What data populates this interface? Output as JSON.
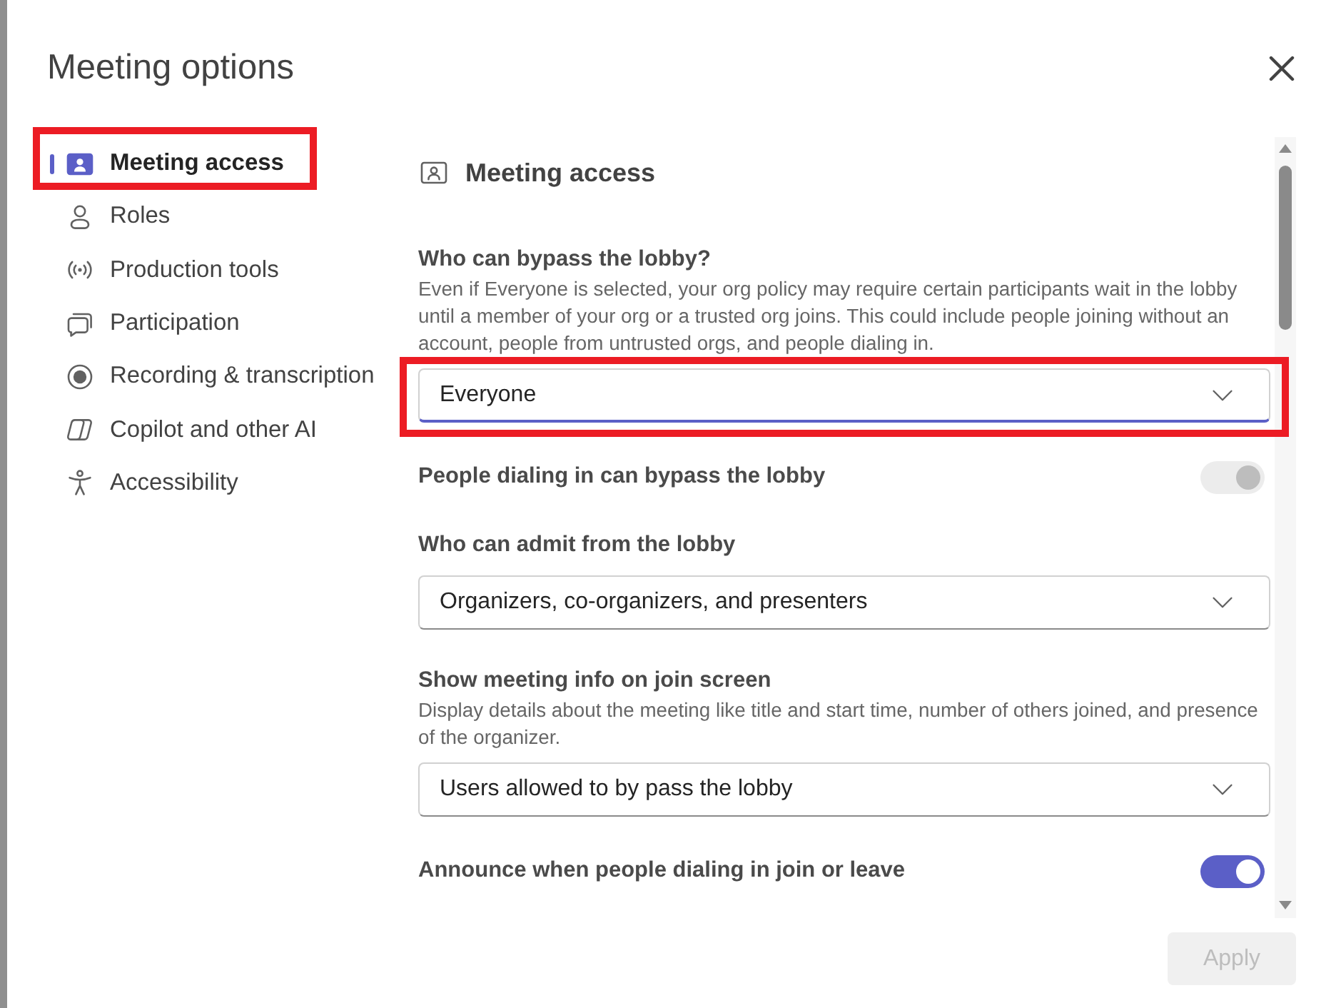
{
  "dialog": {
    "title": "Meeting options"
  },
  "nav": {
    "items": [
      {
        "label": "Meeting access",
        "selected": true,
        "highlighted": true
      },
      {
        "label": "Roles",
        "selected": false,
        "highlighted": false
      },
      {
        "label": "Production tools",
        "selected": false,
        "highlighted": false
      },
      {
        "label": "Participation",
        "selected": false,
        "highlighted": false
      },
      {
        "label": "Recording & transcription",
        "selected": false,
        "highlighted": false
      },
      {
        "label": "Copilot and other AI",
        "selected": false,
        "highlighted": false
      },
      {
        "label": "Accessibility",
        "selected": false,
        "highlighted": false
      }
    ]
  },
  "panel": {
    "title": "Meeting access",
    "settings": [
      {
        "kind": "select",
        "label": "Who can bypass the lobby?",
        "description": "Even if Everyone is selected, your org policy may require certain participants wait in the lobby until a member of your org or a trusted org joins. This could include people joining without an account, people from untrusted orgs, and people dialing in.",
        "value": "Everyone",
        "focused": true,
        "highlighted": true
      },
      {
        "kind": "toggle",
        "label": "People dialing in can bypass the lobby",
        "on": true,
        "disabled": true
      },
      {
        "kind": "select",
        "label": "Who can admit from the lobby",
        "value": "Organizers, co-organizers, and presenters",
        "focused": false,
        "highlighted": false
      },
      {
        "kind": "select",
        "label": "Show meeting info on join screen",
        "description": "Display details about the meeting like title and start time, number of others joined, and presence of the organizer.",
        "value": "Users allowed to by pass the lobby",
        "focused": false,
        "highlighted": false
      },
      {
        "kind": "toggle",
        "label": "Announce when people dialing in join or leave",
        "on": true,
        "disabled": false
      }
    ]
  },
  "apply_button": {
    "label": "Apply",
    "disabled": true
  }
}
